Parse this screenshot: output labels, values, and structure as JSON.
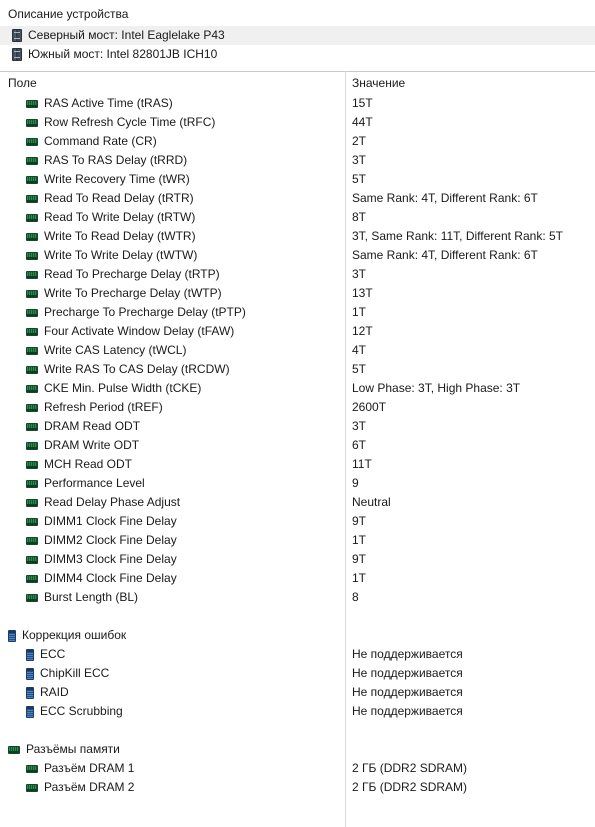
{
  "device_description": {
    "title": "Описание устройства",
    "rows": [
      {
        "icon": "chipset-icon",
        "label": "Северный мост: Intel Eaglelake P43",
        "selected": true
      },
      {
        "icon": "chipset-icon",
        "label": "Южный мост: Intel 82801JB ICH10",
        "selected": false
      }
    ]
  },
  "table": {
    "headers": {
      "field": "Поле",
      "value": "Значение"
    },
    "rows": [
      {
        "icon": "dram-icon",
        "level": "item",
        "field": "RAS Active Time (tRAS)",
        "value": "15T"
      },
      {
        "icon": "dram-icon",
        "level": "item",
        "field": "Row Refresh Cycle Time (tRFC)",
        "value": "44T"
      },
      {
        "icon": "dram-icon",
        "level": "item",
        "field": "Command Rate (CR)",
        "value": "2T"
      },
      {
        "icon": "dram-icon",
        "level": "item",
        "field": "RAS To RAS Delay (tRRD)",
        "value": "3T"
      },
      {
        "icon": "dram-icon",
        "level": "item",
        "field": "Write Recovery Time (tWR)",
        "value": "5T"
      },
      {
        "icon": "dram-icon",
        "level": "item",
        "field": "Read To Read Delay (tRTR)",
        "value": "Same Rank: 4T, Different Rank: 6T"
      },
      {
        "icon": "dram-icon",
        "level": "item",
        "field": "Read To Write Delay (tRTW)",
        "value": "8T"
      },
      {
        "icon": "dram-icon",
        "level": "item",
        "field": "Write To Read Delay (tWTR)",
        "value": "3T, Same Rank: 11T, Different Rank: 5T"
      },
      {
        "icon": "dram-icon",
        "level": "item",
        "field": "Write To Write Delay (tWTW)",
        "value": "Same Rank: 4T, Different Rank: 6T"
      },
      {
        "icon": "dram-icon",
        "level": "item",
        "field": "Read To Precharge Delay (tRTP)",
        "value": "3T"
      },
      {
        "icon": "dram-icon",
        "level": "item",
        "field": "Write To Precharge Delay (tWTP)",
        "value": "13T"
      },
      {
        "icon": "dram-icon",
        "level": "item",
        "field": "Precharge To Precharge Delay (tPTP)",
        "value": "1T"
      },
      {
        "icon": "dram-icon",
        "level": "item",
        "field": "Four Activate Window Delay (tFAW)",
        "value": "12T"
      },
      {
        "icon": "dram-icon",
        "level": "item",
        "field": "Write CAS Latency (tWCL)",
        "value": "4T"
      },
      {
        "icon": "dram-icon",
        "level": "item",
        "field": "Write RAS To CAS Delay (tRCDW)",
        "value": "5T"
      },
      {
        "icon": "dram-icon",
        "level": "item",
        "field": "CKE Min. Pulse Width (tCKE)",
        "value": "Low Phase: 3T, High Phase: 3T"
      },
      {
        "icon": "dram-icon",
        "level": "item",
        "field": "Refresh Period (tREF)",
        "value": "2600T"
      },
      {
        "icon": "dram-icon",
        "level": "item",
        "field": "DRAM Read ODT",
        "value": "3T"
      },
      {
        "icon": "dram-icon",
        "level": "item",
        "field": "DRAM Write ODT",
        "value": "6T"
      },
      {
        "icon": "dram-icon",
        "level": "item",
        "field": "MCH Read ODT",
        "value": "11T"
      },
      {
        "icon": "dram-icon",
        "level": "item",
        "field": "Performance Level",
        "value": "9"
      },
      {
        "icon": "dram-icon",
        "level": "item",
        "field": "Read Delay Phase Adjust",
        "value": "Neutral"
      },
      {
        "icon": "dram-icon",
        "level": "item",
        "field": "DIMM1 Clock Fine Delay",
        "value": "9T"
      },
      {
        "icon": "dram-icon",
        "level": "item",
        "field": "DIMM2 Clock Fine Delay",
        "value": "1T"
      },
      {
        "icon": "dram-icon",
        "level": "item",
        "field": "DIMM3 Clock Fine Delay",
        "value": "9T"
      },
      {
        "icon": "dram-icon",
        "level": "item",
        "field": "DIMM4 Clock Fine Delay",
        "value": "1T"
      },
      {
        "icon": "dram-icon",
        "level": "item",
        "field": "Burst Length (BL)",
        "value": "8"
      },
      {
        "spacer": true
      },
      {
        "icon": "blue-module-icon",
        "level": "group",
        "field": "Коррекция ошибок",
        "value": ""
      },
      {
        "icon": "blue-module-icon",
        "level": "item",
        "field": "ECC",
        "value": "Не поддерживается"
      },
      {
        "icon": "blue-module-icon",
        "level": "item",
        "field": "ChipKill ECC",
        "value": "Не поддерживается"
      },
      {
        "icon": "blue-module-icon",
        "level": "item",
        "field": "RAID",
        "value": "Не поддерживается"
      },
      {
        "icon": "blue-module-icon",
        "level": "item",
        "field": "ECC Scrubbing",
        "value": "Не поддерживается"
      },
      {
        "spacer": true
      },
      {
        "icon": "dram-icon",
        "level": "group",
        "field": "Разъёмы памяти",
        "value": ""
      },
      {
        "icon": "dram-icon",
        "level": "item",
        "field": "Разъём DRAM 1",
        "value": "2 ГБ  (DDR2 SDRAM)"
      },
      {
        "icon": "dram-icon",
        "level": "item",
        "field": "Разъём DRAM 2",
        "value": "2 ГБ  (DDR2 SDRAM)"
      }
    ]
  }
}
